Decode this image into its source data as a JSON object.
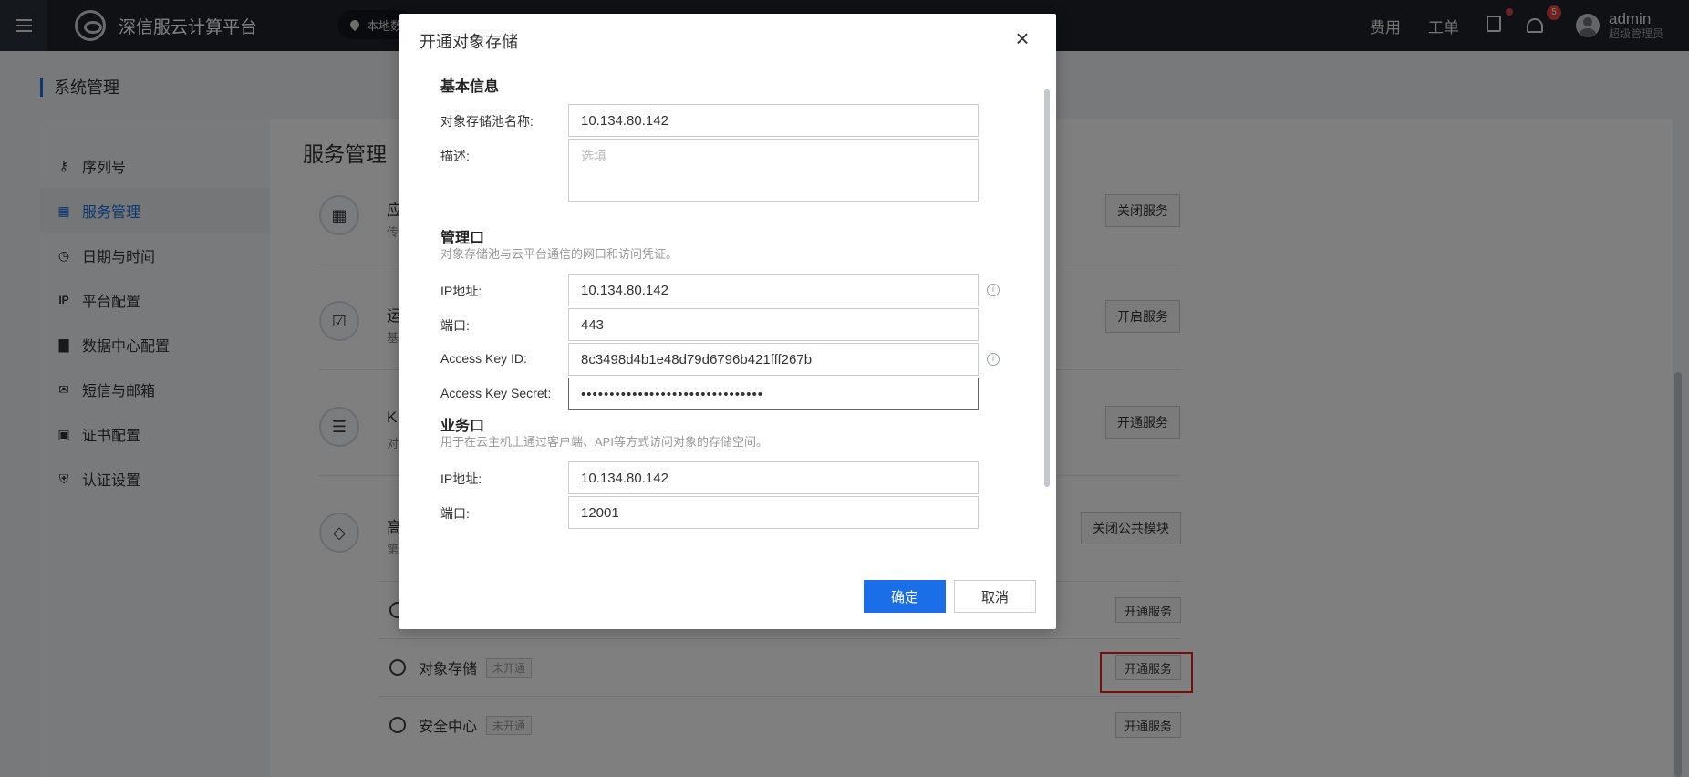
{
  "topbar": {
    "brand": "深信服云计算平台",
    "location": "本地数",
    "links": {
      "billing": "费用",
      "tickets": "工单"
    },
    "notification_count": "5",
    "user": {
      "name": "admin",
      "role": "超级管理员"
    }
  },
  "page": {
    "header": "系统管理",
    "main_title": "服务管理"
  },
  "sidebar": {
    "items": [
      {
        "label": "序列号",
        "icon": "key-icon"
      },
      {
        "label": "服务管理",
        "icon": "grid-icon",
        "active": true
      },
      {
        "label": "日期与时间",
        "icon": "clock-icon"
      },
      {
        "label": "平台配置",
        "icon": "ip-icon"
      },
      {
        "label": "数据中心配置",
        "icon": "bar-chart-icon"
      },
      {
        "label": "短信与邮箱",
        "icon": "mail-icon"
      },
      {
        "label": "证书配置",
        "icon": "certificate-icon"
      },
      {
        "label": "认证设置",
        "icon": "shield-icon"
      }
    ]
  },
  "services": {
    "rows": [
      {
        "title": "应",
        "desc": "传",
        "button": "关闭服务"
      },
      {
        "title": "运",
        "desc": "基",
        "button": "开启服务"
      },
      {
        "title": "K",
        "desc": "对",
        "button": "开通服务"
      },
      {
        "title": "高",
        "desc": "第",
        "button": "关闭公共模块",
        "button_partial": ""
      }
    ],
    "sub_rows": [
      {
        "label": "",
        "button": "开通服务"
      },
      {
        "label": "对象存储",
        "tag": "未开通",
        "button": "开通服务"
      },
      {
        "label": "安全中心",
        "tag": "未开通",
        "button": "开通服务"
      }
    ]
  },
  "modal": {
    "title": "开通对象存储",
    "basic": {
      "title": "基本信息",
      "name_label": "对象存储池名称:",
      "name_value": "10.134.80.142",
      "desc_label": "描述:",
      "desc_placeholder": "选填"
    },
    "mgmt": {
      "title": "管理口",
      "desc": "对象存储池与云平台通信的网口和访问凭证。",
      "ip_label": "IP地址:",
      "ip_value": "10.134.80.142",
      "port_label": "端口:",
      "port_value": "443",
      "key_id_label": "Access Key ID:",
      "key_id_value": "8c3498d4b1e48d79d6796b421fff267b",
      "secret_label": "Access Key Secret:",
      "secret_value": "••••••••••••••••••••••••••••••••"
    },
    "business": {
      "title": "业务口",
      "desc": "用于在云主机上通过客户端、API等方式访问对象的存储空间。",
      "ip_label": "IP地址:",
      "ip_value": "10.134.80.142",
      "port_label": "端口:",
      "port_value": "12001"
    },
    "ok": "确定",
    "cancel": "取消"
  },
  "colors": {
    "primary": "#1a6fe8",
    "topbar": "#1f2329",
    "highlight": "#e02020"
  }
}
